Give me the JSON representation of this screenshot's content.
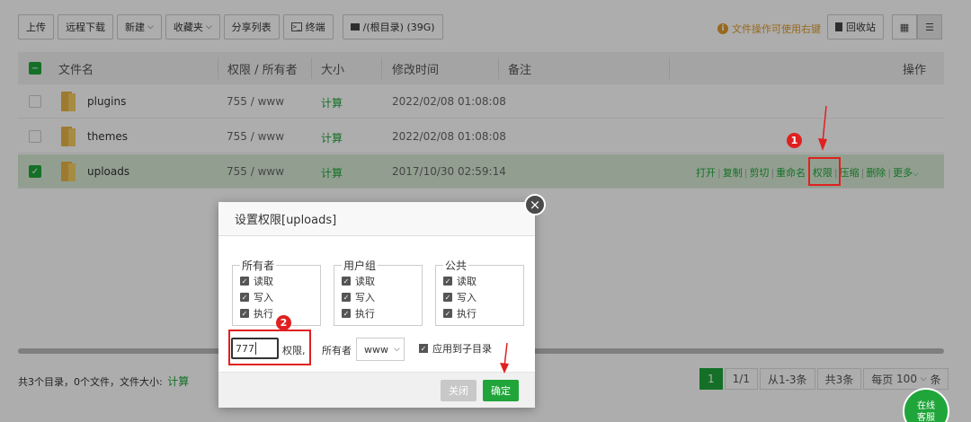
{
  "toolbar": {
    "upload": "上传",
    "remote_download": "远程下载",
    "new": "新建",
    "favorites": "收藏夹",
    "share_list": "分享列表",
    "terminal": "终端",
    "path": "/(根目录) (39G)",
    "tip": "文件操作可使用右键",
    "recycle": "回收站"
  },
  "table": {
    "headers": {
      "name": "文件名",
      "perm_owner": "权限 / 所有者",
      "size": "大小",
      "mtime": "修改时间",
      "note": "备注",
      "ops": "操作"
    },
    "rows": [
      {
        "name": "plugins",
        "perm": "755 / www",
        "size": "计算",
        "mtime": "2022/02/08 01:08:08",
        "selected": false
      },
      {
        "name": "themes",
        "perm": "755 / www",
        "size": "计算",
        "mtime": "2022/02/08 01:08:08",
        "selected": false
      },
      {
        "name": "uploads",
        "perm": "755 / www",
        "size": "计算",
        "mtime": "2017/10/30 02:59:14",
        "selected": true
      }
    ],
    "row_ops": [
      "打开",
      "复制",
      "剪切",
      "重命名",
      "权限",
      "压缩",
      "删除",
      "更多"
    ]
  },
  "footer": {
    "summary": "共3个目录，0个文件，文件大小:",
    "calc": "计算"
  },
  "pager": {
    "current": "1",
    "pages": "1/1",
    "range": "从1-3条",
    "total": "共3条",
    "per_page_label": "每页",
    "per_page": "100",
    "unit": "条"
  },
  "dialog": {
    "title": "设置权限[uploads]",
    "groups": [
      {
        "legend": "所有者",
        "items": [
          "读取",
          "写入",
          "执行"
        ]
      },
      {
        "legend": "用户组",
        "items": [
          "读取",
          "写入",
          "执行"
        ]
      },
      {
        "legend": "公共",
        "items": [
          "读取",
          "写入",
          "执行"
        ]
      }
    ],
    "perm_value": "777",
    "perm_label": "权限,",
    "owner_label": "所有者",
    "owner_value": "www",
    "apply_sub": "应用到子目录",
    "cancel": "关闭",
    "confirm": "确定"
  },
  "annotations": {
    "badge1": "1",
    "badge2": "2"
  },
  "chat": {
    "line1": "在线",
    "line2": "客服"
  },
  "colors": {
    "accent": "#20a53a",
    "annotation": "#e02020",
    "tip": "#e09b2a"
  }
}
